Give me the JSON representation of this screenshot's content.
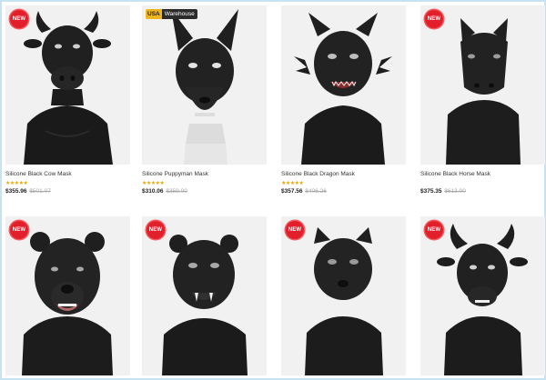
{
  "badges": {
    "new": "NEW",
    "warehouse_prefix": "USA",
    "warehouse_label": "Warehouse"
  },
  "colors": {
    "badge_red": "#e2202c",
    "star": "#e9a800",
    "frame_border": "#c7e3f2"
  },
  "products": [
    {
      "name": "Silicone Black Cow Mask",
      "badge": "new",
      "stars": "★★★★★",
      "price": "$355.96",
      "old_price": "$501.07",
      "icon": "cow-mask"
    },
    {
      "name": "Silicone Puppyman Mask",
      "badge": "warehouse",
      "stars": "★★★★★",
      "price": "$310.06",
      "old_price": "$359.00",
      "icon": "dog-mask"
    },
    {
      "name": "Silicone Black Dragon Mask",
      "badge": "none",
      "stars": "★★★★★",
      "price": "$357.56",
      "old_price": "$406.26",
      "icon": "dragon-mask"
    },
    {
      "name": "Silicone Black Horse Mask",
      "badge": "new",
      "stars": "",
      "price": "$375.35",
      "old_price": "$613.00",
      "icon": "horse-mask"
    },
    {
      "name": "",
      "badge": "new",
      "stars": "",
      "price": "",
      "old_price": "",
      "icon": "bear-mask"
    },
    {
      "name": "",
      "badge": "new",
      "stars": "",
      "price": "",
      "old_price": "",
      "icon": "tiger-mask"
    },
    {
      "name": "",
      "badge": "new",
      "stars": "",
      "price": "",
      "old_price": "",
      "icon": "panther-mask"
    },
    {
      "name": "",
      "badge": "new",
      "stars": "",
      "price": "",
      "old_price": "",
      "icon": "bull-mask"
    }
  ]
}
